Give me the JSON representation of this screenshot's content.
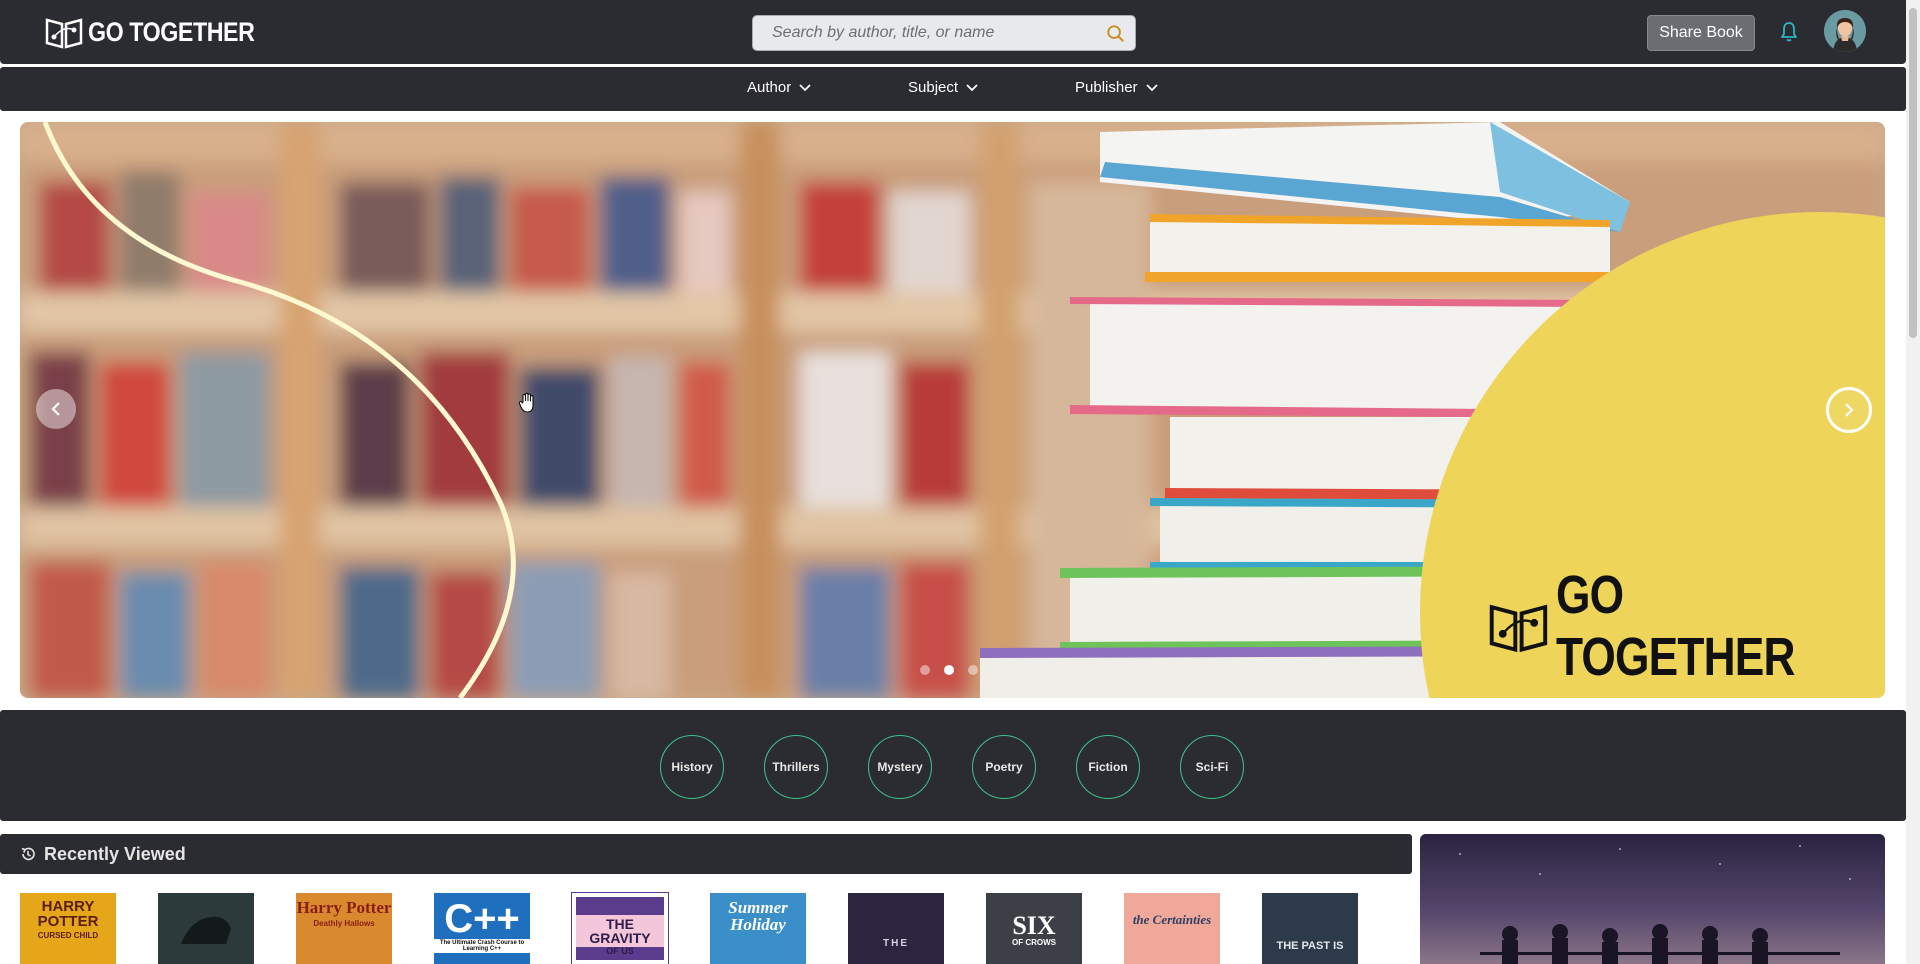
{
  "header": {
    "brand": "GO TOGETHER",
    "search_placeholder": "Search by author, title, or name",
    "share_label": "Share Book"
  },
  "nav": {
    "items": [
      {
        "label": "Author"
      },
      {
        "label": "Subject"
      },
      {
        "label": "Publisher"
      }
    ]
  },
  "hero": {
    "brand": "GO TOGETHER",
    "slide_count": 3,
    "active_slide": 2
  },
  "categories": [
    "History",
    "Thrillers",
    "Mystery",
    "Poetry",
    "Fiction",
    "Sci-Fi"
  ],
  "recently_viewed": {
    "title": "Recently Viewed",
    "books": [
      {
        "cover_text": "HARRY POTTER",
        "subtitle": "CURSED CHILD",
        "color": "#e6a619"
      },
      {
        "cover_text": "",
        "subtitle": "",
        "color": "#2c3a3c"
      },
      {
        "cover_text": "Harry Potter",
        "subtitle": "Deathly Hallows",
        "color": "#d98a2f"
      },
      {
        "cover_text": "C++",
        "subtitle": "The Ultimate Crash Course to Learning C++",
        "color": "#1f6fbf"
      },
      {
        "cover_text": "THE GRAVITY",
        "subtitle": "OF US",
        "color": "#5b3b8c"
      },
      {
        "cover_text": "Summer Holiday",
        "subtitle": "",
        "color": "#3a8fc8"
      },
      {
        "cover_text": "THE",
        "subtitle": "",
        "color": "#2b2540"
      },
      {
        "cover_text": "SIX",
        "subtitle": "OF CROWS",
        "color": "#3c3f46"
      },
      {
        "cover_text": "the Certainties",
        "subtitle": "",
        "color": "#f0a89a"
      },
      {
        "cover_text": "THE PAST IS",
        "subtitle": "",
        "color": "#2d3a4a"
      }
    ]
  }
}
